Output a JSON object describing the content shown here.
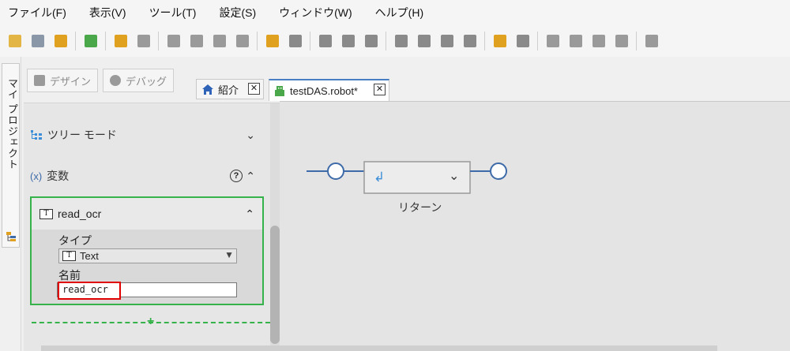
{
  "menu": [
    "ファイル(F)",
    "表示(V)",
    "ツール(T)",
    "設定(S)",
    "ウィンドウ(W)",
    "ヘルプ(H)"
  ],
  "toolbar_icons": [
    "open-folder-icon",
    "save-all-icon",
    "sync-icon",
    "sep",
    "add-robot-icon",
    "sep",
    "undo-icon",
    "redo-icon",
    "sep",
    "copy-icon",
    "cut-icon",
    "paste-icon",
    "delete-icon",
    "sep",
    "run-icon",
    "stop-icon",
    "sep",
    "step-back-icon",
    "play-icon",
    "pause-icon",
    "sep",
    "step-into-icon",
    "step-over-icon",
    "step-out-icon",
    "resume-icon",
    "sep",
    "tag-icon",
    "target-icon",
    "sep",
    "zoom-in-icon",
    "zoom-out-icon",
    "fit-icon",
    "expand-icon",
    "sep",
    "settings-icon"
  ],
  "side_tab": {
    "label": "マイ プロジェクト"
  },
  "modes": {
    "design": "デザイン",
    "debug": "デバッグ"
  },
  "sections": {
    "tree_mode": "ツリー モード",
    "variables_icon": "(x)",
    "variables": "変数",
    "help": "?"
  },
  "variable": {
    "name": "read_ocr",
    "icon_letter": "T",
    "type_label": "タイプ",
    "type_value": "Text",
    "name_label": "名前",
    "name_value": "read_ocr"
  },
  "tabs": [
    {
      "label": "紹介",
      "close": "✕"
    },
    {
      "label": "testDAS.robot*",
      "close": "✕"
    }
  ],
  "flow": {
    "step_label": "リターン",
    "step_icon": "↲",
    "chevron": "⌄"
  },
  "colors": {
    "accent_green": "#35b24a",
    "highlight_red": "#e00000",
    "flow_blue": "#3d6aa8",
    "tab_active": "#4a7ec2"
  }
}
